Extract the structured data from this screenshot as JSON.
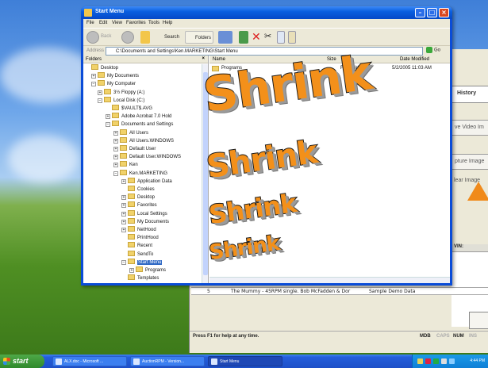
{
  "window": {
    "title": "Start Menu",
    "menu": [
      "File",
      "Edit",
      "View",
      "Favorites",
      "Tools",
      "Help"
    ],
    "toolbar": {
      "back": "Back",
      "search": "Search",
      "folders": "Folders"
    },
    "address_label": "Address",
    "address_value": "C:\\Documents and Settings\\Ken.MARKETING\\Start Menu",
    "go_label": "Go"
  },
  "folders_pane": {
    "header": "Folders",
    "close": "×",
    "tree": [
      {
        "label": "Desktop",
        "expander": ""
      },
      {
        "label": "My Documents",
        "expander": "+"
      },
      {
        "label": "My Computer",
        "expander": "−"
      },
      {
        "label": "3½ Floppy (A:)",
        "expander": "+"
      },
      {
        "label": "Local Disk (C:)",
        "expander": "−"
      },
      {
        "label": "$VAULT$.AVG",
        "expander": ""
      },
      {
        "label": "Adobe Acrobat 7.0 Hold",
        "expander": "+"
      },
      {
        "label": "Documents and Settings",
        "expander": "−"
      },
      {
        "label": "All Users",
        "expander": "+"
      },
      {
        "label": "All Users.WINDOWS",
        "expander": "+"
      },
      {
        "label": "Default User",
        "expander": "+"
      },
      {
        "label": "Default User.WINDOWS",
        "expander": "+"
      },
      {
        "label": "Ken",
        "expander": "+"
      },
      {
        "label": "Ken.MARKETING",
        "expander": "−"
      },
      {
        "label": "Application Data",
        "expander": "+"
      },
      {
        "label": "Cookies",
        "expander": ""
      },
      {
        "label": "Desktop",
        "expander": "+"
      },
      {
        "label": "Favorites",
        "expander": "+"
      },
      {
        "label": "Local Settings",
        "expander": "+"
      },
      {
        "label": "My Documents",
        "expander": "+"
      },
      {
        "label": "NetHood",
        "expander": "+"
      },
      {
        "label": "PrintHood",
        "expander": ""
      },
      {
        "label": "Recent",
        "expander": ""
      },
      {
        "label": "SendTo",
        "expander": ""
      },
      {
        "label": "Start Menu",
        "expander": "−",
        "selected": true
      },
      {
        "label": "Programs",
        "expander": "+"
      },
      {
        "label": "Templates",
        "expander": ""
      }
    ]
  },
  "files_pane": {
    "columns": [
      "Name",
      "Size",
      "Type",
      "Date Modified"
    ],
    "rows": [
      {
        "name": "Programs",
        "size": "",
        "type": "File Folder",
        "date": "5/2/2005 11:03 AM"
      }
    ]
  },
  "overlay": {
    "word": "Shrink"
  },
  "background_app": {
    "tab": "History",
    "buttons": [
      "ve Video Im",
      "pture Image",
      "lear Image"
    ],
    "column": "VIN:",
    "row": {
      "num": "5",
      "title": "The Mummy - 45RPM single. Bob McFadden & Dor",
      "source": "Sample Demo Data"
    },
    "status_help": "Press F1 for help at any time.",
    "indicators": [
      "MDB",
      "CAPS",
      "NUM",
      "INS"
    ]
  },
  "taskbar": {
    "start": "start",
    "tasks": [
      "ALX.doc - Microsoft ...",
      "AuctionRPM - Version...",
      "Start Menu"
    ],
    "clock": "4:44 PM"
  },
  "colors": {
    "accent_orange": "#f3901a",
    "xp_blue": "#0a4cd8",
    "selection": "#316ac5"
  }
}
